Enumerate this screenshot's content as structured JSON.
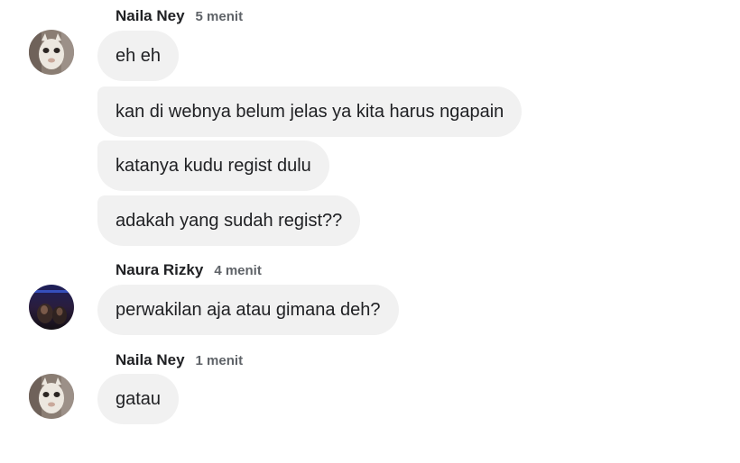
{
  "messages": [
    {
      "sender": "Naila Ney",
      "time": "5 menit",
      "avatar_icon": "cat-face-avatar",
      "bubbles": [
        "eh eh",
        "kan di webnya belum jelas ya kita harus ngapain",
        "katanya kudu regist dulu",
        "adakah yang sudah regist??"
      ]
    },
    {
      "sender": "Naura Rizky",
      "time": "4 menit",
      "avatar_icon": "night-photo-avatar",
      "bubbles": [
        "perwakilan aja atau gimana deh?"
      ]
    },
    {
      "sender": "Naila Ney",
      "time": "1 menit",
      "avatar_icon": "cat-face-avatar",
      "bubbles": [
        "gatau"
      ]
    }
  ],
  "colors": {
    "bubble_bg": "#f1f1f1",
    "text": "#202124",
    "timestamp": "#5f6368"
  }
}
